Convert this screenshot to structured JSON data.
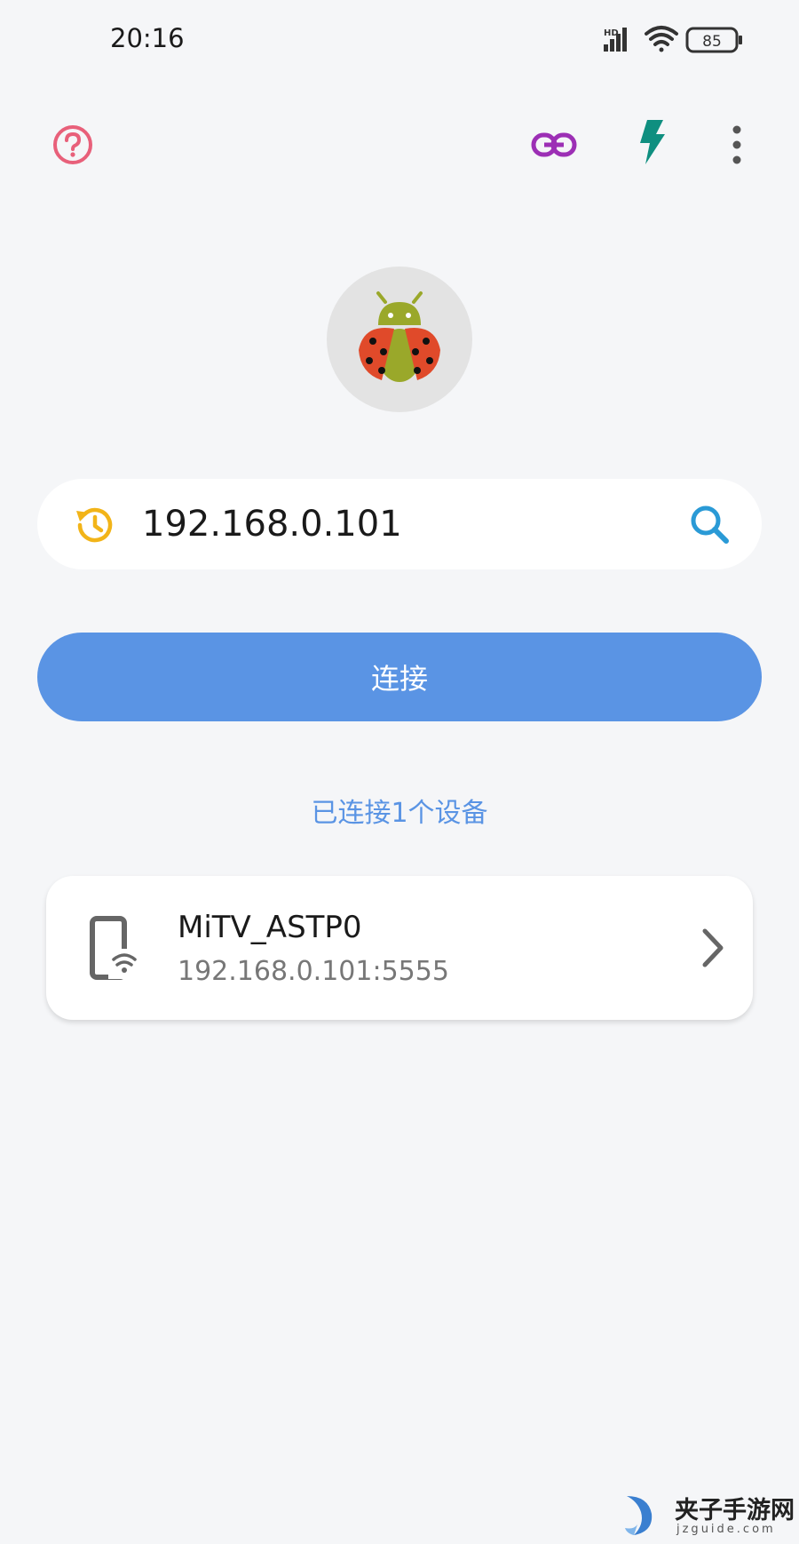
{
  "status_bar": {
    "time": "20:16",
    "network": "HD",
    "battery": "85"
  },
  "toolbar": {
    "help_icon": "help-circle-icon",
    "link_icon": "link-icon",
    "flash_icon": "lightning-icon",
    "more_icon": "more-vertical-icon"
  },
  "logo": {
    "icon": "ladybug-android-icon"
  },
  "address": {
    "value": "192.168.0.101",
    "history_icon": "history-icon",
    "search_icon": "search-icon"
  },
  "connect_button": {
    "label": "连接"
  },
  "connected_count_text": "已连接1个设备",
  "devices": [
    {
      "name": "MiTV_ASTP0",
      "address": "192.168.0.101:5555",
      "icon": "phone-wifi-icon"
    }
  ],
  "watermark": {
    "title": "夹子手游网",
    "url": "jzguide.com"
  },
  "colors": {
    "accent": "#5a94e4",
    "help": "#e8607a",
    "link": "#9c2fb5",
    "flash": "#0f8f80",
    "history": "#f2b418",
    "search": "#2a9ad6"
  }
}
